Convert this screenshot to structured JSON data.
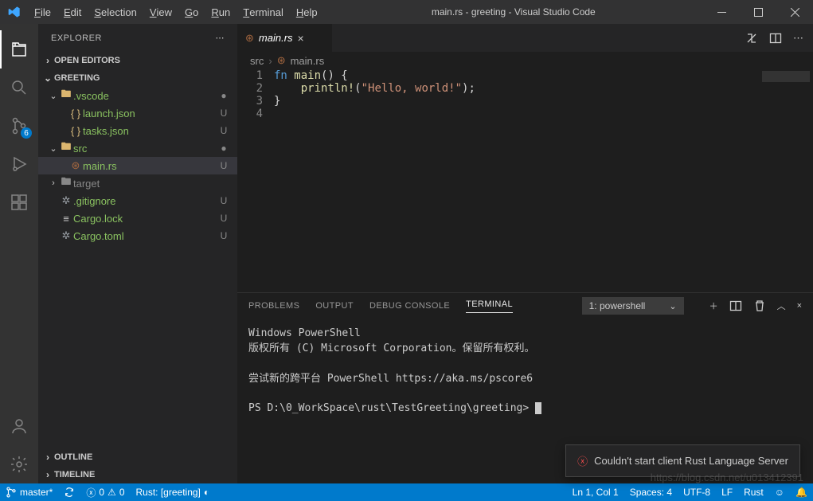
{
  "title": "main.rs - greeting - Visual Studio Code",
  "menubar": [
    "File",
    "Edit",
    "Selection",
    "View",
    "Go",
    "Run",
    "Terminal",
    "Help"
  ],
  "activitybar": {
    "scm_badge": "6"
  },
  "sidebar": {
    "title": "EXPLORER",
    "sections": {
      "openEditors": "OPEN EDITORS",
      "folder": "GREETING",
      "outline": "OUTLINE",
      "timeline": "TIMELINE"
    },
    "tree": {
      "vscode": {
        "label": ".vscode",
        "dot": "●"
      },
      "launch": {
        "label": "launch.json",
        "git": "U"
      },
      "tasks": {
        "label": "tasks.json",
        "git": "U"
      },
      "src": {
        "label": "src",
        "dot": "●"
      },
      "mainrs": {
        "label": "main.rs",
        "git": "U"
      },
      "target": {
        "label": "target"
      },
      "gitignore": {
        "label": ".gitignore",
        "git": "U"
      },
      "cargolock": {
        "label": "Cargo.lock",
        "git": "U"
      },
      "cargotoml": {
        "label": "Cargo.toml",
        "git": "U"
      }
    }
  },
  "tab": {
    "label": "main.rs"
  },
  "breadcrumbs": {
    "a": "src",
    "b": "main.rs"
  },
  "code": {
    "l1": {
      "n": "1",
      "kw": "fn ",
      "fn": "main",
      "rest": "() {"
    },
    "l2": {
      "n": "2",
      "indent": "    ",
      "mac": "println!",
      "open": "(",
      "str": "\"Hello, world!\"",
      "close": ");"
    },
    "l3": {
      "n": "3",
      "text": "}"
    },
    "l4": {
      "n": "4",
      "text": ""
    }
  },
  "panel": {
    "tabs": {
      "problems": "PROBLEMS",
      "output": "OUTPUT",
      "debug": "DEBUG CONSOLE",
      "terminal": "TERMINAL"
    },
    "termSelect": "1: powershell",
    "terminalLines": {
      "a": "Windows PowerShell",
      "b": "版权所有 (C) Microsoft Corporation。保留所有权利。",
      "c": "",
      "d": "尝试新的跨平台 PowerShell https://aka.ms/pscore6",
      "e": "",
      "f": "PS D:\\0_WorkSpace\\rust\\TestGreeting\\greeting> "
    }
  },
  "toast": {
    "msg": "Couldn't start client Rust Language Server"
  },
  "status": {
    "branch": "master*",
    "sync": "",
    "errors": "0",
    "warnings": "0",
    "rust": "Rust: [greeting]",
    "lncol": "Ln 1, Col 1",
    "spaces": "Spaces: 4",
    "enc": "UTF-8",
    "eol": "LF",
    "lang": "Rust",
    "feedback": "",
    "bell": ""
  },
  "watermark": "https://blog.csdn.net/u013412391"
}
